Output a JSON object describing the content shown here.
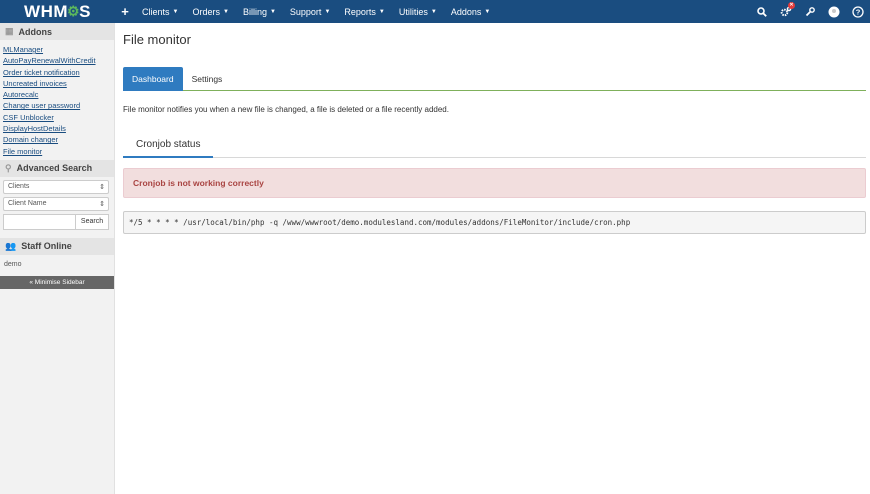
{
  "brand": {
    "logo_text_left": "WHM",
    "logo_text_right": "S"
  },
  "nav": {
    "items": [
      "Clients",
      "Orders",
      "Billing",
      "Support",
      "Reports",
      "Utilities",
      "Addons"
    ],
    "notification_count": "✕"
  },
  "sidebar": {
    "addons_title": "Addons",
    "links": [
      "MLManager",
      "AutoPayRenewalWithCredit",
      "Order ticket notification",
      "Uncreated invoices",
      "Autorecalc",
      "Change user password",
      "CSF Unblocker",
      "DisplayHostDetails",
      "Domain changer",
      "File monitor"
    ],
    "advanced_search_title": "Advanced Search",
    "search_type": "Clients",
    "search_field": "Client Name",
    "search_button": "Search",
    "staff_title": "Staff Online",
    "staff": [
      "demo"
    ],
    "minimise_label": "« Minimise Sidebar"
  },
  "main": {
    "title": "File monitor",
    "tabs": [
      "Dashboard",
      "Settings"
    ],
    "description": "File monitor notifies you when a new file is changed, a file is deleted or a file recently added.",
    "cron_tab": "Cronjob status",
    "alert": "Cronjob is not working correctly",
    "cron_command": "*/5 * * * * /usr/local/bin/php -q /www/wwwroot/demo.modulesland.com/modules/addons/FileMonitor/include/cron.php"
  }
}
